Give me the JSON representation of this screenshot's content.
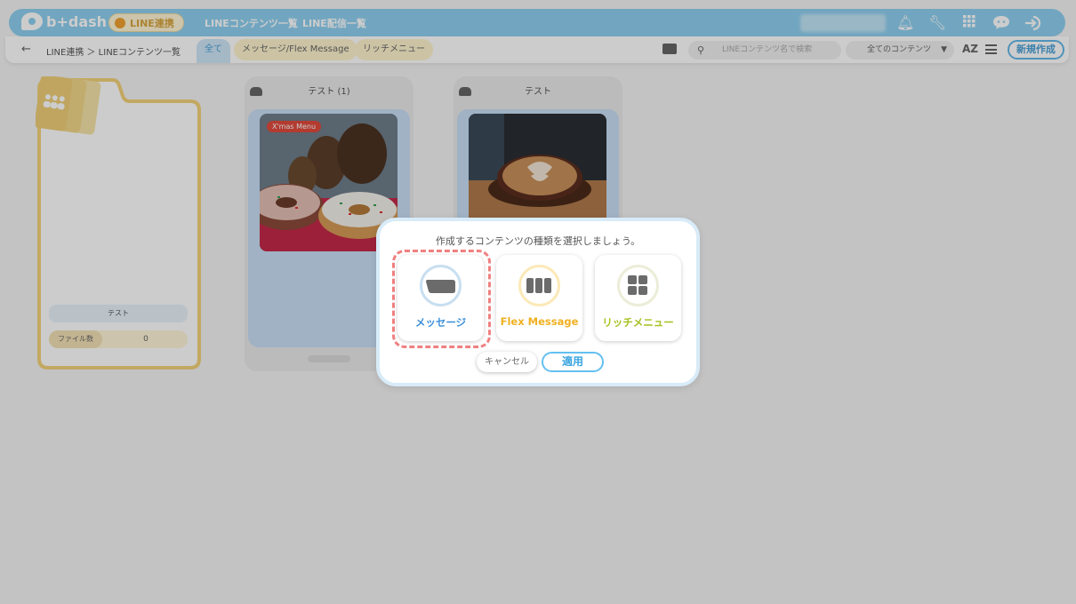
{
  "header": {
    "logo_text": "b+dash",
    "line_badge": "LINE連携",
    "nav": [
      "LINEコンテンツ一覧",
      "LINE配信一覧"
    ],
    "icons": [
      "bell-icon",
      "wrench-icon",
      "apps-grid-icon",
      "chat-bot-icon",
      "logout-icon"
    ]
  },
  "toolbar": {
    "breadcrumb": "LINE連携 ＞ LINEコンテンツ一覧",
    "tabs": [
      "全て",
      "メッセージ/Flex Message",
      "リッチメニュー"
    ],
    "search_placeholder": "LINEコンテンツ名で検索",
    "filter_value": "全てのコンテンツ",
    "sort_label": "AZ",
    "new_button": "新規作成"
  },
  "folder": {
    "name": "テスト",
    "count_label": "ファイル数",
    "count_value": "0"
  },
  "cards": [
    {
      "title": "テスト (1)",
      "badge": "X'mas Menu",
      "image": "donuts-and-pinecones"
    },
    {
      "title": "テスト",
      "image": "latte-coffee-cup"
    }
  ],
  "dialog": {
    "title": "作成するコンテンツの種類を選択しましょう。",
    "options": [
      {
        "label": "メッセージ",
        "color": "#3a8fd8",
        "ring": "#c8dff0",
        "icon": "message-bubble-icon",
        "selected": true
      },
      {
        "label": "Flex Message",
        "color": "#f0b020",
        "ring": "#fbe9b8",
        "icon": "flex-columns-icon",
        "selected": false
      },
      {
        "label": "リッチメニュー",
        "color": "#a8c020",
        "ring": "#ecedd8",
        "icon": "rich-menu-grid-icon",
        "selected": false
      }
    ],
    "cancel": "キャンセル",
    "apply": "適用"
  },
  "colors": {
    "brand": "#5fbbe6",
    "accent_yellow": "#f3d27a"
  }
}
